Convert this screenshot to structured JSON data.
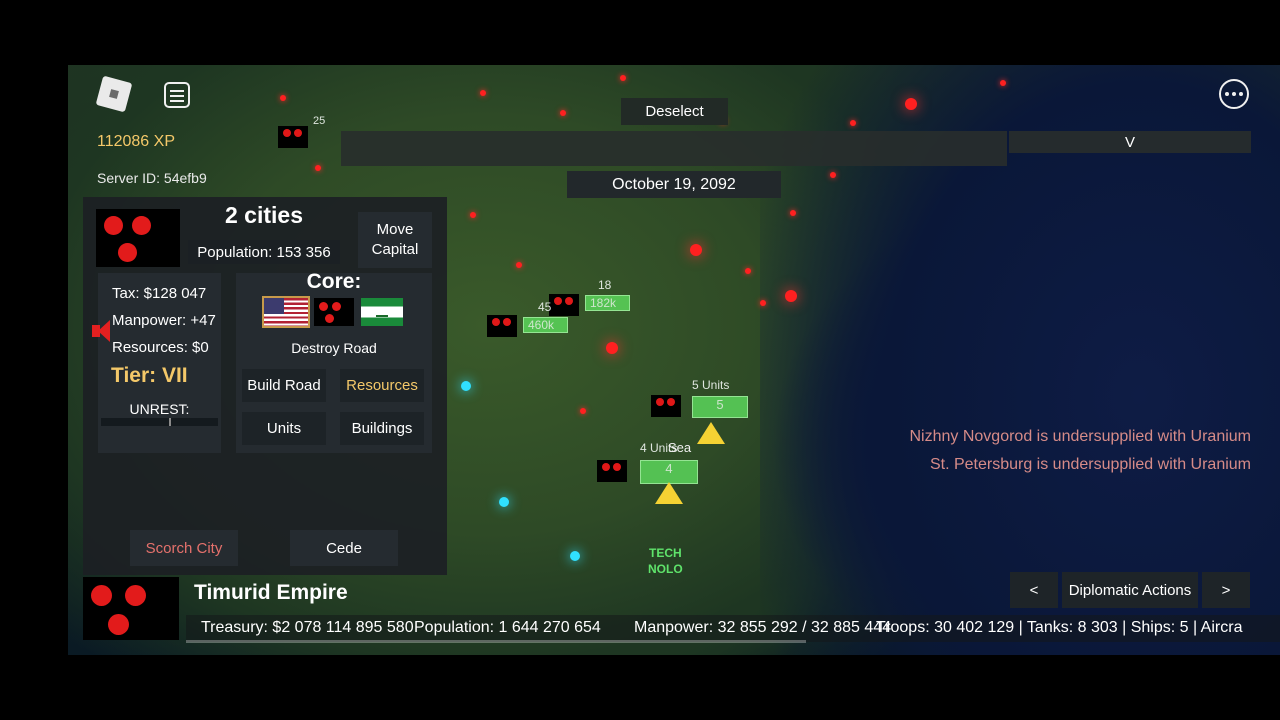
{
  "hud": {
    "xp": "112086 XP",
    "server_id": "Server ID: 54efb9",
    "deselect": "Deselect",
    "v_button": "V",
    "date": "October 19, 2092"
  },
  "city_panel": {
    "title": "2 cities",
    "population": "Population: 153 356",
    "move_capital": "Move Capital",
    "tax": "Tax: $128 047",
    "manpower": "Manpower: +47",
    "resources": "Resources: $0",
    "tier": "Tier: VII",
    "unrest_label": "UNREST:",
    "core_label": "Core:",
    "destroy_road": "Destroy Road",
    "build_road": "Build Road",
    "resources_button": "Resources",
    "units_button": "Units",
    "buildings_button": "Buildings",
    "scorch_city": "Scorch City",
    "cede": "Cede"
  },
  "nation": {
    "name": "Timurid Empire",
    "treasury": "Treasury:  $2 078 114 895 580",
    "population": "Population: 1 644 270 654",
    "manpower": "Manpower:  32 855 292  /  32 885 444",
    "troops_tail": "Troops: 30 402 129  |  Tanks: 8 303  |  Ships: 5  |  Aircra"
  },
  "diplomacy": {
    "prev": "<",
    "label": "Diplomatic Actions",
    "next": ">"
  },
  "notifications": [
    "Nizhny Novgorod is undersupplied with Uranium",
    "St. Petersburg is undersupplied with Uranium"
  ],
  "map_labels": {
    "units_5": "5 Units",
    "units_4": "4 Units",
    "sea": "Sea",
    "tech_1": "TECH",
    "tech_2": "NOLO",
    "label_18": "18",
    "label_182k": "182k",
    "label_45": "45",
    "label_460k": "460k",
    "label_25": "25",
    "label_5": "5",
    "label_4": "4"
  },
  "colors": {
    "accent_gold": "#f4c869",
    "nation_red": "#e21b1b",
    "unit_green": "#5bd65b",
    "notice_text": "#d68b88"
  }
}
